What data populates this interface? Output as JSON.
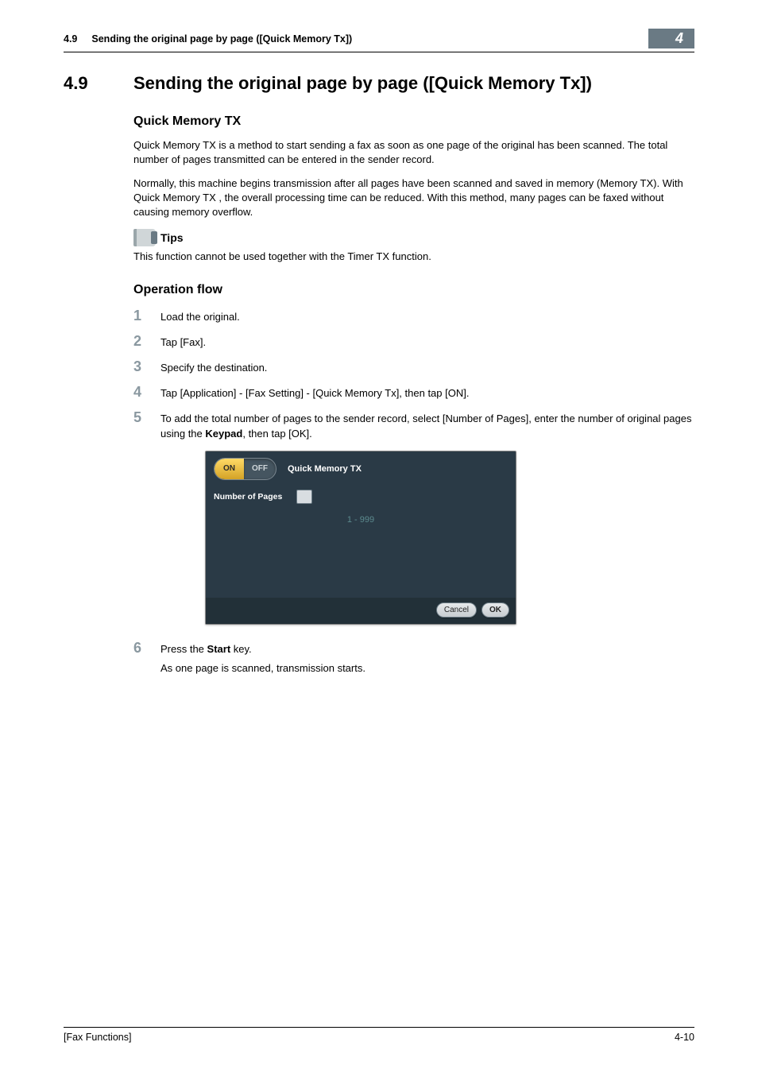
{
  "header": {
    "section": "4.9",
    "title": "Sending the original page by page ([Quick Memory Tx])",
    "chapter": "4"
  },
  "h1": {
    "num": "4.9",
    "title": "Sending the original page by page ([Quick Memory Tx])"
  },
  "quick_memory": {
    "heading": "Quick Memory TX",
    "p1": "Quick Memory TX is a method to start sending a fax as soon as one page of the original has been scanned. The total number of pages transmitted can be entered in the sender record.",
    "p2": "Normally, this machine begins transmission after all pages have been scanned and saved in memory (Memory TX). With Quick Memory TX , the overall processing time can be reduced. With this method, many pages can be faxed without causing memory overflow."
  },
  "tips": {
    "label": "Tips",
    "text": "This function cannot be used together with the Timer TX function."
  },
  "opflow": {
    "heading": "Operation flow",
    "steps": {
      "s1": {
        "num": "1",
        "text": "Load the original."
      },
      "s2": {
        "num": "2",
        "text": "Tap [Fax]."
      },
      "s3": {
        "num": "3",
        "text": "Specify the destination."
      },
      "s4": {
        "num": "4",
        "text": "Tap [Application] - [Fax Setting] - [Quick Memory Tx], then tap [ON]."
      },
      "s5": {
        "num": "5",
        "pre": "To add the total number of pages to the sender record, select [Number of Pages], enter the number of original pages using the ",
        "bold": "Keypad",
        "post": ", then tap [OK]."
      },
      "s6": {
        "num": "6",
        "pre": "Press the ",
        "bold": "Start",
        "post": " key.",
        "sub": "As one page is scanned, transmission starts."
      }
    }
  },
  "screenshot": {
    "on": "ON",
    "off": "OFF",
    "title": "Quick Memory TX",
    "nop_label": "Number of Pages",
    "range": "1 - 999",
    "cancel": "Cancel",
    "ok": "OK"
  },
  "footer": {
    "left": "[Fax Functions]",
    "right": "4-10"
  }
}
